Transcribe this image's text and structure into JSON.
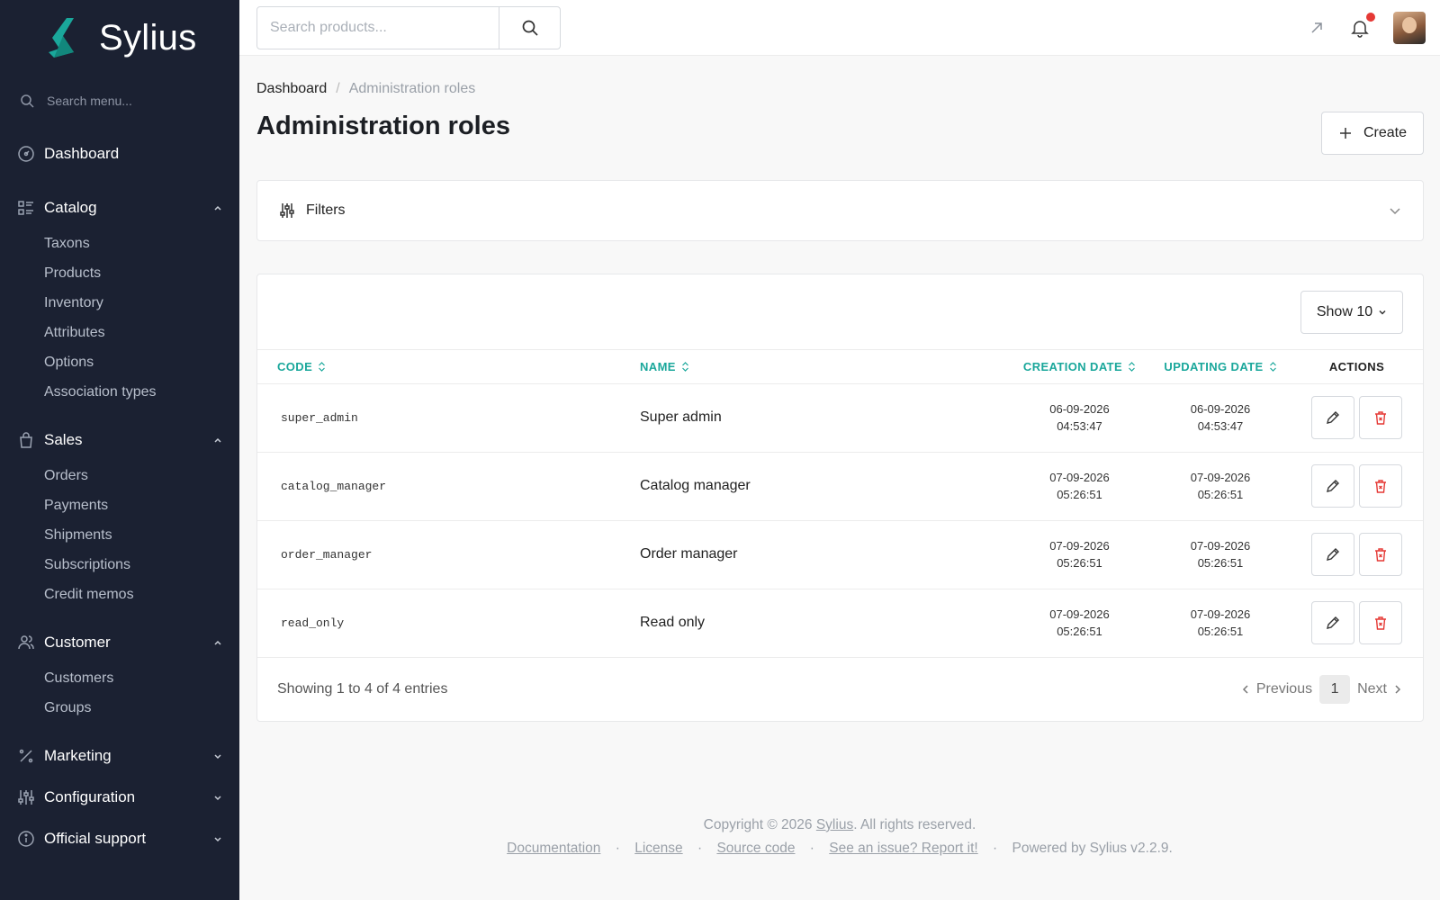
{
  "brand": {
    "name": "Sylius"
  },
  "sidebar": {
    "search_placeholder": "Search menu...",
    "dashboard": "Dashboard",
    "catalog": {
      "label": "Catalog",
      "items": [
        "Taxons",
        "Products",
        "Inventory",
        "Attributes",
        "Options",
        "Association types"
      ]
    },
    "sales": {
      "label": "Sales",
      "items": [
        "Orders",
        "Payments",
        "Shipments",
        "Subscriptions",
        "Credit memos"
      ]
    },
    "customer": {
      "label": "Customer",
      "items": [
        "Customers",
        "Groups"
      ]
    },
    "marketing": "Marketing",
    "configuration": "Configuration",
    "official_support": "Official support"
  },
  "topbar": {
    "search_placeholder": "Search products..."
  },
  "breadcrumb": {
    "home": "Dashboard",
    "separator": "/",
    "current": "Administration roles"
  },
  "page": {
    "title": "Administration roles",
    "create_label": "Create"
  },
  "filters": {
    "label": "Filters"
  },
  "table": {
    "show_label": "Show 10",
    "columns": {
      "code": "CODE",
      "name": "NAME",
      "creation_date": "CREATION DATE",
      "updating_date": "UPDATING DATE",
      "actions": "ACTIONS"
    },
    "rows": [
      {
        "code": "super_admin",
        "name": "Super admin",
        "created_date": "06-09-2026",
        "created_time": "04:53:47",
        "updated_date": "06-09-2026",
        "updated_time": "04:53:47"
      },
      {
        "code": "catalog_manager",
        "name": "Catalog manager",
        "created_date": "07-09-2026",
        "created_time": "05:26:51",
        "updated_date": "07-09-2026",
        "updated_time": "05:26:51"
      },
      {
        "code": "order_manager",
        "name": "Order manager",
        "created_date": "07-09-2026",
        "created_time": "05:26:51",
        "updated_date": "07-09-2026",
        "updated_time": "05:26:51"
      },
      {
        "code": "read_only",
        "name": "Read only",
        "created_date": "07-09-2026",
        "created_time": "05:26:51",
        "updated_date": "07-09-2026",
        "updated_time": "05:26:51"
      }
    ],
    "entries_text": "Showing 1 to 4 of 4 entries",
    "pager": {
      "previous": "Previous",
      "page": "1",
      "next": "Next"
    }
  },
  "footer": {
    "copyright_pre": "Copyright © 2026 ",
    "copyright_link": "Sylius",
    "copyright_post": ". All rights reserved.",
    "links": [
      "Documentation",
      "License",
      "Source code",
      "See an issue? Report it!"
    ],
    "separator": "·",
    "powered": "Powered by Sylius v2.2.9."
  },
  "colors": {
    "sidebar_bg": "#1b2132",
    "accent": "#1aa79b",
    "danger": "#e53935"
  },
  "icons": [
    "sylius-logo-icon",
    "search-icon",
    "dashboard-icon",
    "catalog-icon",
    "bag-icon",
    "users-icon",
    "percent-icon",
    "sliders-icon",
    "info-icon",
    "chevron-up-icon",
    "chevron-down-icon",
    "external-link-icon",
    "bell-icon",
    "plus-icon",
    "filter-icon",
    "sort-icon",
    "pencil-icon",
    "trash-icon",
    "chevron-left-icon",
    "chevron-right-icon"
  ]
}
